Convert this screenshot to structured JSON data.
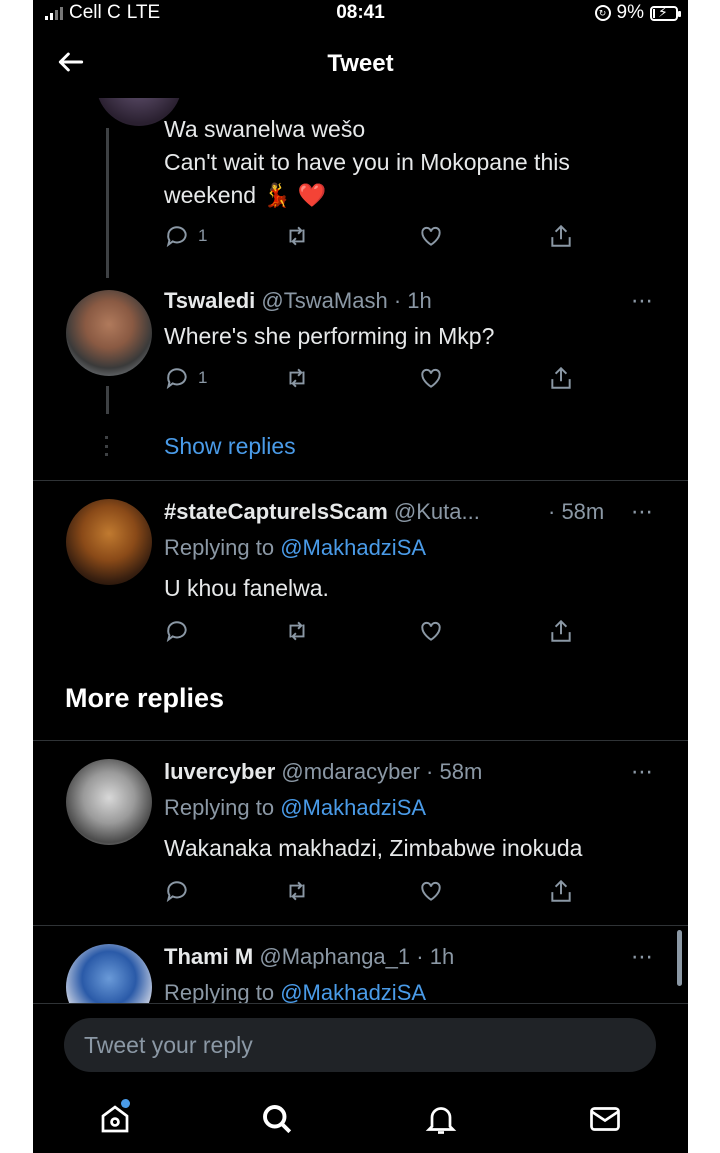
{
  "status_bar": {
    "carrier": "Cell C",
    "network": "LTE",
    "time": "08:41",
    "battery": "9%"
  },
  "header": {
    "title": "Tweet",
    "back_icon": "arrow-left-icon"
  },
  "tweets": [
    {
      "body_lines": [
        "Wa swanelwa wešo",
        "Can't wait to have you in Mokopane this",
        "weekend 💃 ❤️"
      ],
      "reply_count": "1"
    },
    {
      "name": "Tswaledi",
      "handle": "@TswaMash",
      "time": "· 1h",
      "body": "Where's she performing in Mkp?",
      "reply_count": "1"
    },
    {
      "name": "#stateCaptureIsScam",
      "handle": "@Kuta...",
      "time": "· 58m",
      "replying_prefix": "Replying to",
      "replying_to": "@MakhadziSA",
      "body": "U khou fanelwa."
    },
    {
      "name": "luvercyber",
      "handle": "@mdaracyber",
      "time": "· 58m",
      "replying_prefix": "Replying to",
      "replying_to": "@MakhadziSA",
      "body": "Wakanaka makhadzi, Zimbabwe inokuda"
    },
    {
      "name": "Thami M",
      "handle": "@Maphanga_1",
      "time": "· 1h",
      "replying_prefix": "Replying to",
      "replying_to": "@MakhadziSA"
    }
  ],
  "show_replies": "Show replies",
  "more_replies_heading": "More replies",
  "more_icon": "⋯",
  "reply_input": {
    "placeholder": "Tweet your reply"
  },
  "tab_bar": [
    "home-icon",
    "search-icon",
    "notifications-icon",
    "messages-icon"
  ],
  "colors": {
    "background": "#000000",
    "link": "#4a9be8",
    "muted": "#8b98a5",
    "text": "#e7e9ea"
  }
}
